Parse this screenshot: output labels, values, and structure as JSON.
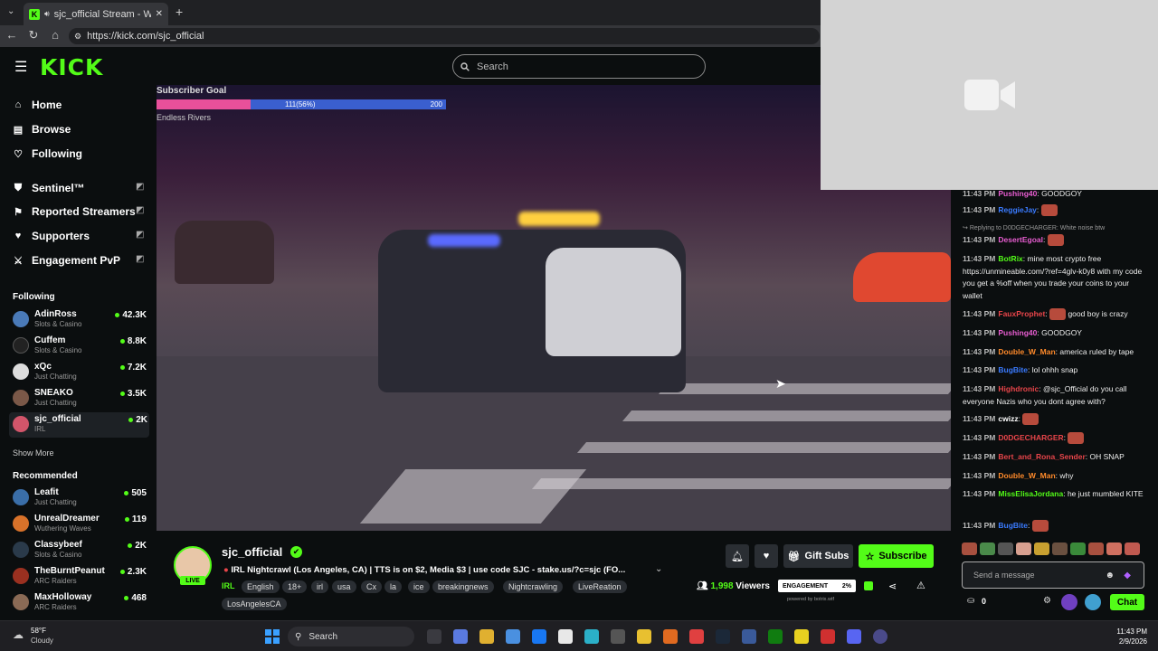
{
  "browser": {
    "tab_title": "sjc_official Stream - Watch Li",
    "url": "https://kick.com/sjc_official"
  },
  "site": {
    "logo": "KICK",
    "search_placeholder": "Search"
  },
  "sidebar": {
    "nav": [
      {
        "label": "Home",
        "icon": "home-icon"
      },
      {
        "label": "Browse",
        "icon": "browse-icon"
      },
      {
        "label": "Following",
        "icon": "heart-icon"
      }
    ],
    "mod_nav": [
      {
        "label": "Sentinel™",
        "icon": "shield-icon"
      },
      {
        "label": "Reported Streamers",
        "icon": "flag-icon"
      },
      {
        "label": "Supporters",
        "icon": "heart-icon"
      },
      {
        "label": "Engagement PvP",
        "icon": "swords-icon"
      }
    ],
    "following_title": "Following",
    "following": [
      {
        "name": "AdinRoss",
        "category": "Slots & Casino",
        "viewers": "42.3K"
      },
      {
        "name": "Cuffem",
        "category": "Slots & Casino",
        "viewers": "8.8K"
      },
      {
        "name": "xQc",
        "category": "Just Chatting",
        "viewers": "7.2K"
      },
      {
        "name": "SNEAKO",
        "category": "Just Chatting",
        "viewers": "3.5K"
      },
      {
        "name": "sjc_official",
        "category": "IRL",
        "viewers": "2K"
      }
    ],
    "show_more": "Show More",
    "recommended_title": "Recommended",
    "recommended": [
      {
        "name": "Leafit",
        "category": "Just Chatting",
        "viewers": "505"
      },
      {
        "name": "UnrealDreamer",
        "category": "Wuthering Waves",
        "viewers": "119"
      },
      {
        "name": "Classybeef",
        "category": "Slots & Casino",
        "viewers": "2K"
      },
      {
        "name": "TheBurntPeanut",
        "category": "ARC Raiders",
        "viewers": "2.3K"
      },
      {
        "name": "MaxHolloway",
        "category": "ARC Raiders",
        "viewers": "468"
      }
    ]
  },
  "overlay": {
    "goal_title": "Subscriber Goal",
    "goal_current": "111(56%)",
    "goal_max": "200",
    "goal_fraction": 0.56,
    "goal_sub": "Endless Rivers"
  },
  "chat": {
    "messages": [
      {
        "time": "11:43 PM",
        "user": "Pushing40",
        "color": "#e85dd1",
        "text": "GOODGOY",
        "emote": false
      },
      {
        "time": "11:43 PM",
        "user": "ReggieJay",
        "color": "#3a7bff",
        "text": "",
        "emote": true
      },
      {
        "time": "",
        "user": "",
        "color": "#999999",
        "text": "Replying to D0DGECHARGER: White noise btw",
        "emote": false,
        "reply": true
      },
      {
        "time": "11:43 PM",
        "user": "DesertEgoal",
        "color": "#e85dd1",
        "text": "",
        "emote": true
      },
      {
        "time": "11:43 PM",
        "user": "BotRix",
        "color": "#53fc18",
        "text": "mine most crypto free https://unmineable.com/?ref=4glv-k0y8 with my code you get a %off when you trade your coins to your wallet",
        "emote": false
      },
      {
        "time": "11:43 PM",
        "user": "FauxProphet",
        "color": "#e8454a",
        "text": "good boy is crazy",
        "emote": true
      },
      {
        "time": "11:43 PM",
        "user": "Pushing40",
        "color": "#e85dd1",
        "text": "GOODGOY",
        "emote": false
      },
      {
        "time": "11:43 PM",
        "user": "Double_W_Man",
        "color": "#ff8a2a",
        "text": "america ruled by tape",
        "emote": false
      },
      {
        "time": "11:43 PM",
        "user": "BugBite",
        "color": "#3a7bff",
        "text": "lol ohhh snap",
        "emote": false
      },
      {
        "time": "11:43 PM",
        "user": "Highdronic",
        "color": "#e8454a",
        "text": "@sjc_Official do you call everyone Nazis who you dont agree with?",
        "emote": false
      },
      {
        "time": "11:43 PM",
        "user": "cwizz",
        "color": "#ffffff",
        "text": "",
        "emote": true
      },
      {
        "time": "11:43 PM",
        "user": "D0DGECHARGER",
        "color": "#e8454a",
        "text": "",
        "emote": true
      },
      {
        "time": "11:43 PM",
        "user": "Bert_and_Rona_Sender",
        "color": "#e8454a",
        "text": "OH SNAP",
        "emote": false
      },
      {
        "time": "11:43 PM",
        "user": "Double_W_Man",
        "color": "#ff8a2a",
        "text": "why",
        "emote": false
      },
      {
        "time": "11:43 PM",
        "user": "MissElisaJordana",
        "color": "#53fc18",
        "text": "he just mumbled KITE",
        "emote": false
      },
      {
        "time": "11:43 PM",
        "user": "BugBite",
        "color": "#3a7bff",
        "text": "",
        "emote": true
      }
    ],
    "input_placeholder": "Send a message",
    "points": "0",
    "chat_button": "Chat"
  },
  "stream": {
    "streamer": "sjc_official",
    "live_label": "LIVE",
    "title": "IRL Nightcrawl (Los Angeles, CA) | TTS is on $2, Media $3 | use code SJC - stake.us/?c=sjc (FO...",
    "category": "IRL",
    "tags": [
      "English",
      "18+",
      "irl",
      "usa",
      "Cx",
      "la",
      "ice",
      "breakingnews",
      "Nightcrawling",
      "LiveReation",
      "LosAngelesCA"
    ],
    "gift_subs": "Gift Subs",
    "subscribe": "Subscribe",
    "viewers": "1,998",
    "viewers_label": "Viewers",
    "engagement_label": "ENGAGEMENT",
    "engagement_value": "2%",
    "powered_by": "powered by botrix.wtf"
  },
  "taskbar": {
    "temp": "58°F",
    "weather": "Cloudy",
    "search": "Search",
    "time": "11:43 PM",
    "date": "2/9/2026"
  },
  "colors": {
    "accent": "#53fc18",
    "background": "#0b0e0f"
  }
}
